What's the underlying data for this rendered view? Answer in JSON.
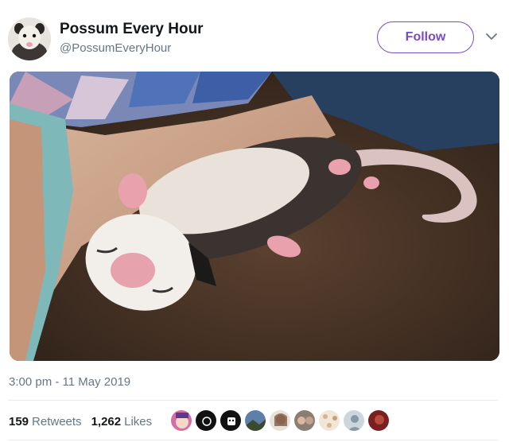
{
  "user": {
    "name": "Possum Every Hour",
    "handle": "@PossumEveryHour"
  },
  "follow": {
    "label": "Follow"
  },
  "media": {
    "alt": "possum-photo"
  },
  "timestamp": "3:00 pm - 11 May 2019",
  "stats": {
    "retweets": {
      "count": "159",
      "label": "Retweets"
    },
    "likes": {
      "count": "1,262",
      "label": "Likes"
    }
  },
  "colors": {
    "accent": "#794bc4",
    "secondary_text": "#657786",
    "divider": "#e6ecf0"
  },
  "likers": [
    "anime-avatar",
    "black-circle-avatar",
    "emoji-avatar",
    "landscape-avatar",
    "person-avatar",
    "group-avatar",
    "pattern-avatar",
    "default-avatar",
    "red-avatar"
  ]
}
